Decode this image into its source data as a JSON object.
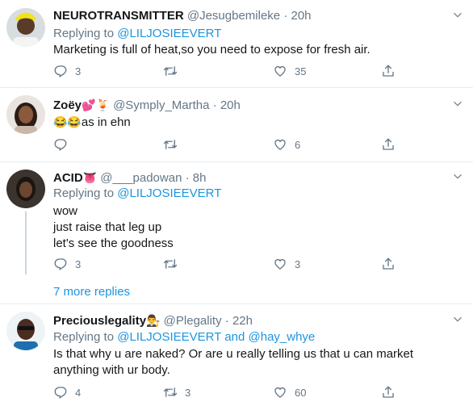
{
  "tweets": [
    {
      "name": "NEUROTRANSMITTER",
      "handle": "@Jesugbemileke",
      "time": "20h",
      "replying_prefix": "Replying to ",
      "replying_to": "@LILJOSIEEVERT",
      "text": "Marketing is full of heat,so you need to expose for fresh air.",
      "replies": "3",
      "retweets": "",
      "likes": "35"
    },
    {
      "name": "Zoëy",
      "name_emojis": "💕🍹",
      "handle": "@Symply_Martha",
      "time": "20h",
      "text_emojis": "😂😂",
      "text": "as in ehn",
      "replies": "",
      "retweets": "",
      "likes": "6"
    },
    {
      "name": "ACID",
      "name_emojis": "👅",
      "handle": "@___padowan",
      "time": "8h",
      "replying_prefix": "Replying to ",
      "replying_to": "@LILJOSIEEVERT",
      "text_lines": [
        "wow",
        "just raise that leg up",
        "let's see the goodness"
      ],
      "replies": "3",
      "retweets": "",
      "likes": "3"
    },
    {
      "name": "Preciouslegality",
      "name_emojis": "👨‍⚖️",
      "handle": "@Plegality",
      "time": "22h",
      "replying_prefix": "Replying to ",
      "replying_to": "@LILJOSIEEVERT",
      "replying_and": " and ",
      "replying_to_2": "@hay_whye",
      "text": "Is that why u are naked? Or are u really telling us that u can market anything with ur body.",
      "replies": "4",
      "retweets": "3",
      "likes": "60"
    }
  ],
  "more_replies": "7 more replies",
  "sep": "·",
  "colors": {
    "link": "#1b95e0",
    "muted": "#657786",
    "divider": "#e6ecf0",
    "thread": "#ccd6dd"
  },
  "icons": [
    "reply-icon",
    "retweet-icon",
    "like-icon",
    "share-icon",
    "caret-down-icon"
  ]
}
